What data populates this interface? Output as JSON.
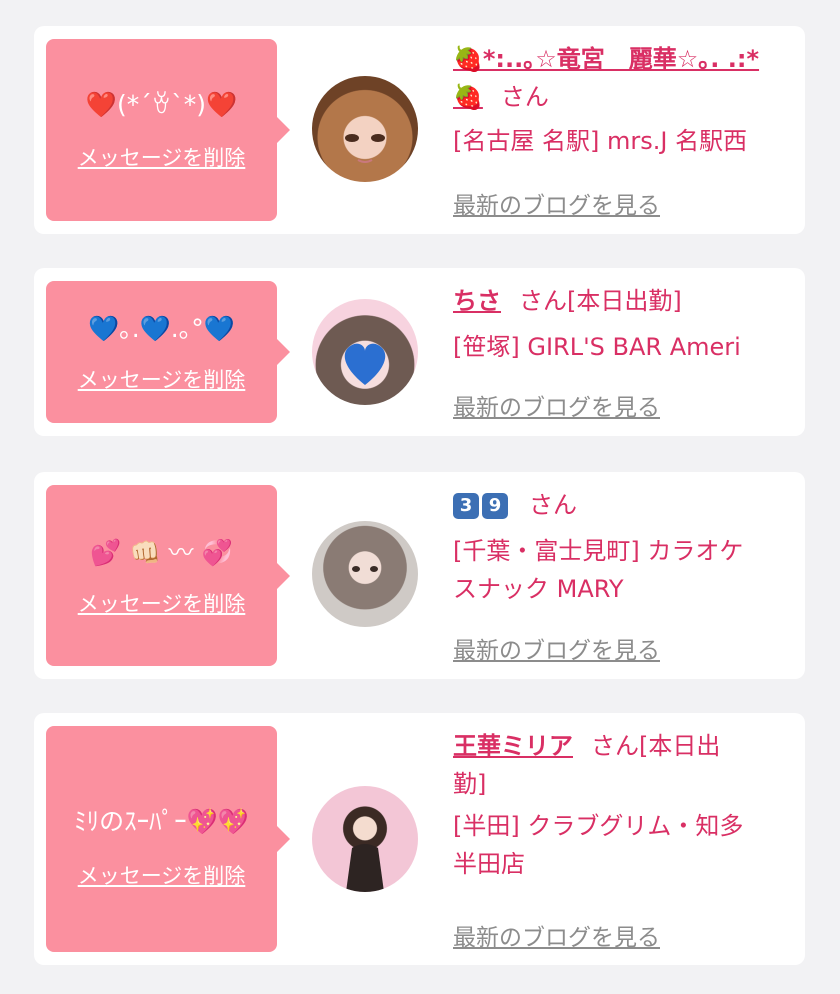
{
  "colors": {
    "accent": "#d92f64",
    "bubble": "#fb909f",
    "link_gray": "#8c8c8c"
  },
  "common": {
    "delete_label": "メッセージを削除",
    "blog_label": "最新のブログを見る"
  },
  "cards": [
    {
      "message": "❤️(*´ꈊ`*)❤️",
      "name_line1": "🍓*:..｡☆竜宮　麗華☆｡. .:*",
      "name_line2": "🍓",
      "san": "さん",
      "shop": "[名古屋 名駅] mrs.J 名駅西"
    },
    {
      "message": "💙｡.💙.｡°💙",
      "name": "ちさ",
      "san": "さん",
      "status": "[本日出勤]",
      "shop": "[笹塚] GIRL'S BAR Ameri"
    },
    {
      "message": "💕 👊🏻 〰 💞",
      "num1": "3",
      "num2": "9",
      "san": "さん",
      "shop_line1": "[千葉・富士見町] カラオケ",
      "shop_line2": "スナック MARY"
    },
    {
      "message": "ﾐﾘのｽｰﾊﾟｰ💖💖",
      "name": "王華ミリア",
      "san": "さん",
      "status_line1": "[本日出",
      "status_line2": "勤]",
      "shop_line1": "[半田] クラブグリム・知多",
      "shop_line2": "半田店"
    }
  ]
}
